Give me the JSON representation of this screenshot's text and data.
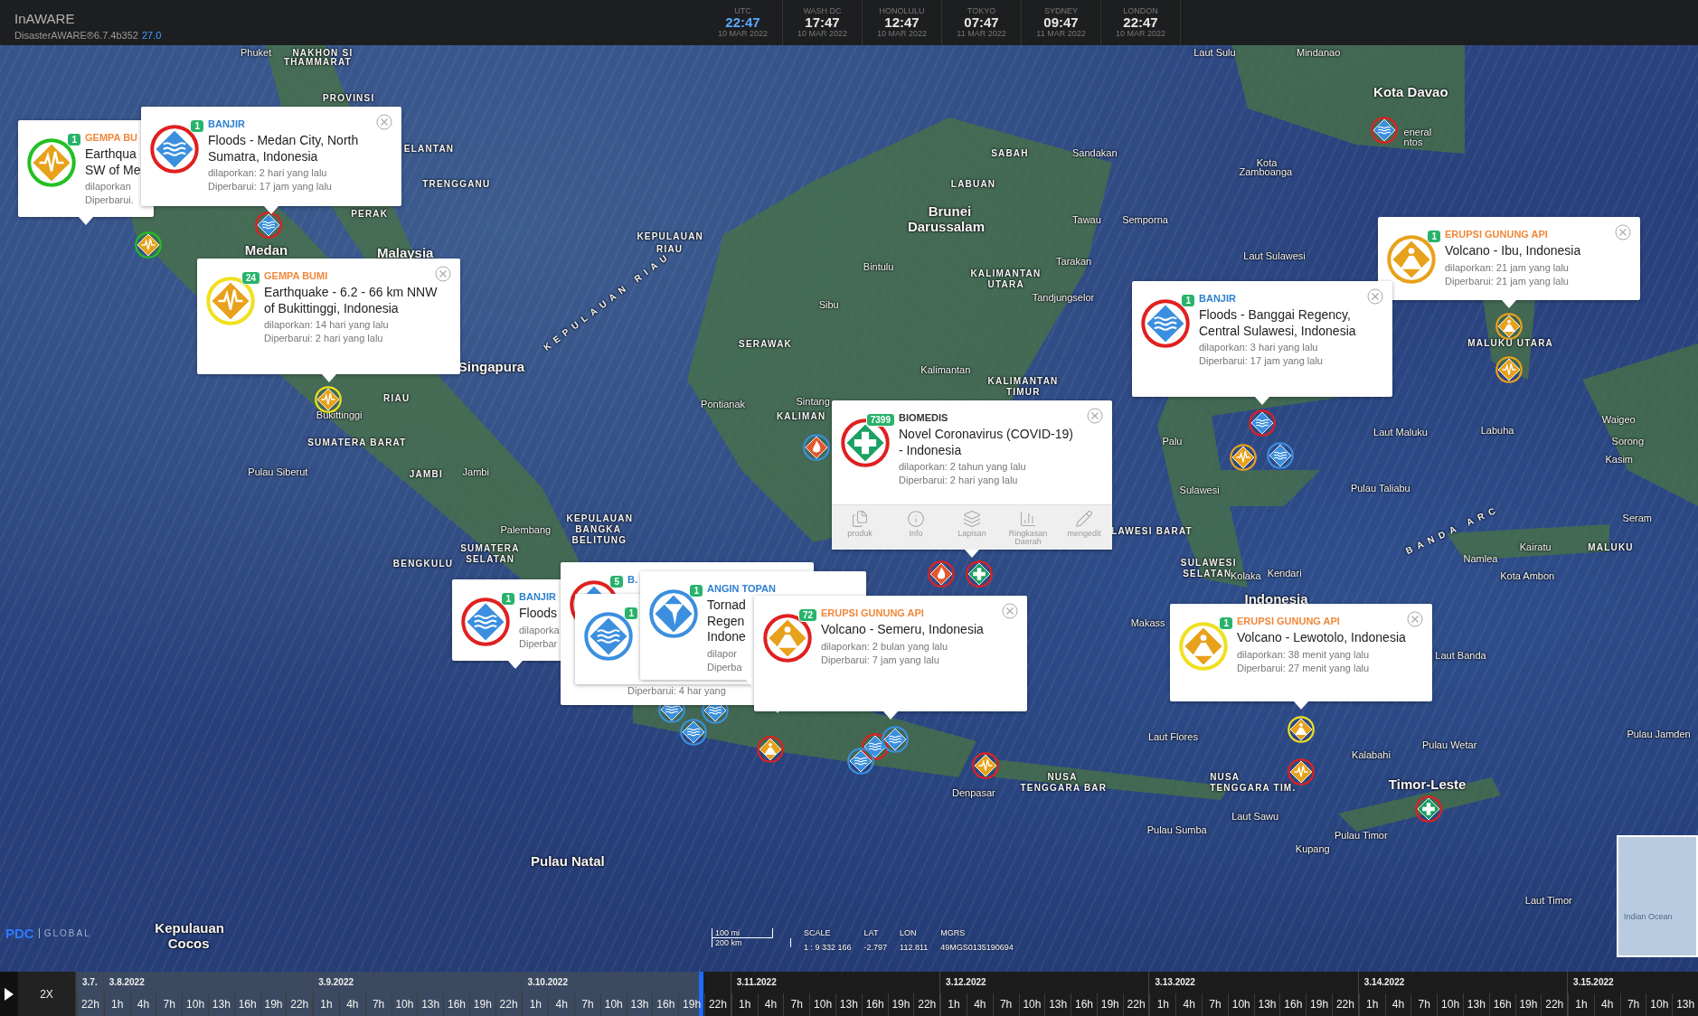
{
  "top_bar": {
    "app_name": "InAWARE",
    "version": "DisasterAWARE®6.7.4b352",
    "build": "27.0",
    "clocks": [
      {
        "city": "UTC",
        "time": "22:47",
        "date": "10 MAR 2022",
        "selected": true
      },
      {
        "city": "WASH DC",
        "time": "17:47",
        "date": "10 MAR 2022",
        "selected": false
      },
      {
        "city": "HONOLULU",
        "time": "12:47",
        "date": "10 MAR 2022",
        "selected": false
      },
      {
        "city": "TOKYO",
        "time": "07:47",
        "date": "11 MAR 2022",
        "selected": false
      },
      {
        "city": "SYDNEY",
        "time": "09:47",
        "date": "11 MAR 2022",
        "selected": false
      },
      {
        "city": "LONDON",
        "time": "22:47",
        "date": "10 MAR 2022",
        "selected": false
      }
    ]
  },
  "map": {
    "labels": [
      {
        "text": "Phuket",
        "kind": "place"
      },
      {
        "text": "NAKHON SI",
        "kind": "region"
      },
      {
        "text": "THAMMARAT",
        "kind": "region"
      },
      {
        "text": "PROVINSI",
        "kind": "region"
      },
      {
        "text": "ELANTAN",
        "kind": "region"
      },
      {
        "text": "TRENGGANU",
        "kind": "region"
      },
      {
        "text": "PERAK",
        "kind": "region"
      },
      {
        "text": "Medan",
        "kind": "country"
      },
      {
        "text": "Malaysia",
        "kind": "country"
      },
      {
        "text": "Singapura",
        "kind": "country"
      },
      {
        "text": "RIAU",
        "kind": "region"
      },
      {
        "text": "Bukittinggi",
        "kind": "place"
      },
      {
        "text": "SUMATERA BARAT",
        "kind": "region"
      },
      {
        "text": "Pulau Siberut",
        "kind": "place"
      },
      {
        "text": "JAMBI",
        "kind": "region"
      },
      {
        "text": "Jambi",
        "kind": "place"
      },
      {
        "text": "KEPULAUAN",
        "kind": "region"
      },
      {
        "text": "RIAU",
        "kind": "region"
      },
      {
        "text": "KEPULAUAN RIAU",
        "kind": "arc"
      },
      {
        "text": "Palembang",
        "kind": "place"
      },
      {
        "text": "KEPULAUAN",
        "kind": "region"
      },
      {
        "text": "BANGKA",
        "kind": "region"
      },
      {
        "text": "BELITUNG",
        "kind": "region"
      },
      {
        "text": "SUMATERA",
        "kind": "region"
      },
      {
        "text": "SELATAN",
        "kind": "region"
      },
      {
        "text": "BENGKULU",
        "kind": "region"
      },
      {
        "text": "Pontianak",
        "kind": "place"
      },
      {
        "text": "Sintang",
        "kind": "place"
      },
      {
        "text": "KALIMAN",
        "kind": "region"
      },
      {
        "text": "Sibu",
        "kind": "place"
      },
      {
        "text": "Bintulu",
        "kind": "place"
      },
      {
        "text": "SERAWAK",
        "kind": "region"
      },
      {
        "text": "SABAH",
        "kind": "region"
      },
      {
        "text": "Sandakan",
        "kind": "place"
      },
      {
        "text": "LABUAN",
        "kind": "region"
      },
      {
        "text": "Brunei",
        "kind": "country"
      },
      {
        "text": "Darussalam",
        "kind": "country"
      },
      {
        "text": "Tawau",
        "kind": "place"
      },
      {
        "text": "Semporna",
        "kind": "place"
      },
      {
        "text": "KALIMANTAN",
        "kind": "region"
      },
      {
        "text": "UTARA",
        "kind": "region"
      },
      {
        "text": "Tarakan",
        "kind": "place"
      },
      {
        "text": "Tandjungselor",
        "kind": "place"
      },
      {
        "text": "Kalimantan",
        "kind": "place"
      },
      {
        "text": "KALIMANTAN",
        "kind": "region"
      },
      {
        "text": "TIMUR",
        "kind": "region"
      },
      {
        "text": "Laut Sulu",
        "kind": "place"
      },
      {
        "text": "Mindanao",
        "kind": "place"
      },
      {
        "text": "Kota",
        "kind": "place"
      },
      {
        "text": "Zamboanga",
        "kind": "place"
      },
      {
        "text": "Kota Davao",
        "kind": "country"
      },
      {
        "text": "eneral",
        "kind": "place"
      },
      {
        "text": "ntos",
        "kind": "place"
      },
      {
        "text": "Laut Sulawesi",
        "kind": "place"
      },
      {
        "text": "MALUKU UTARA",
        "kind": "region"
      },
      {
        "text": "Labuha",
        "kind": "place"
      },
      {
        "text": "Laut Maluku",
        "kind": "place"
      },
      {
        "text": "Waigeo",
        "kind": "place"
      },
      {
        "text": "Sorong",
        "kind": "place"
      },
      {
        "text": "Kasim",
        "kind": "place"
      },
      {
        "text": "Seram",
        "kind": "place"
      },
      {
        "text": "Kairatu",
        "kind": "place"
      },
      {
        "text": "MALUKU",
        "kind": "region"
      },
      {
        "text": "Namlea",
        "kind": "place"
      },
      {
        "text": "Kota Ambon",
        "kind": "place"
      },
      {
        "text": "BANDA ARC",
        "kind": "arc"
      },
      {
        "text": "Palu",
        "kind": "place"
      },
      {
        "text": "Sulawesi",
        "kind": "place"
      },
      {
        "text": "Pulau Taliabu",
        "kind": "place"
      },
      {
        "text": "LAWESI BARAT",
        "kind": "region"
      },
      {
        "text": "SULAWESI",
        "kind": "region"
      },
      {
        "text": "SELATAN",
        "kind": "region"
      },
      {
        "text": "Kolaka",
        "kind": "place"
      },
      {
        "text": "Kendari",
        "kind": "place"
      },
      {
        "text": "Indonesia",
        "kind": "country"
      },
      {
        "text": "Makass",
        "kind": "place"
      },
      {
        "text": "Laut Banda",
        "kind": "place"
      },
      {
        "text": "Laut Flores",
        "kind": "place"
      },
      {
        "text": "Pulau Wetar",
        "kind": "place"
      },
      {
        "text": "Kalabahi",
        "kind": "place"
      },
      {
        "text": "NUSA",
        "kind": "region"
      },
      {
        "text": "TENGGARA TIM.",
        "kind": "region"
      },
      {
        "text": "Timor-Leste",
        "kind": "country"
      },
      {
        "text": "Laut Sawu",
        "kind": "place"
      },
      {
        "text": "Pulau Sumba",
        "kind": "place"
      },
      {
        "text": "Pulau Timor",
        "kind": "place"
      },
      {
        "text": "Kupang",
        "kind": "place"
      },
      {
        "text": "Laut Timor",
        "kind": "place"
      },
      {
        "text": "Pulau Jamden",
        "kind": "place"
      },
      {
        "text": "Denpasar",
        "kind": "place"
      },
      {
        "text": "NUSA",
        "kind": "region"
      },
      {
        "text": "TENGGARA BAR",
        "kind": "region"
      },
      {
        "text": "Pulau Natal",
        "kind": "country"
      },
      {
        "text": "Kepulauan",
        "kind": "country"
      },
      {
        "text": "Cocos",
        "kind": "country"
      }
    ],
    "markers": [
      {
        "kind": "earthquake",
        "color": "#22c022"
      },
      {
        "kind": "flood",
        "color": "#e02020"
      },
      {
        "kind": "earthquake",
        "color": "#f0e020"
      },
      {
        "kind": "flood",
        "color": "#e02020"
      },
      {
        "kind": "volcano",
        "color": "#e8a11a"
      },
      {
        "kind": "earthquake",
        "color": "#e8a11a"
      },
      {
        "kind": "flood",
        "color": "#e02020"
      },
      {
        "kind": "earthquake",
        "color": "#e8a11a"
      },
      {
        "kind": "flood",
        "color": "#3b8fde"
      },
      {
        "kind": "fire",
        "color": "#3b8fde"
      },
      {
        "kind": "fire",
        "color": "#e02020"
      },
      {
        "kind": "biomedical",
        "color": "#e02020"
      },
      {
        "kind": "volcano",
        "color": "#f0e020"
      },
      {
        "kind": "earthquake",
        "color": "#e02020"
      },
      {
        "kind": "biomedical",
        "color": "#e02020"
      },
      {
        "kind": "earthquake",
        "color": "#e02020"
      },
      {
        "kind": "volcano",
        "color": "#e02020"
      },
      {
        "kind": "flood",
        "color": "#3b8fde"
      },
      {
        "kind": "flood",
        "color": "#e02020"
      },
      {
        "kind": "flood",
        "color": "#3b8fde"
      },
      {
        "kind": "flood",
        "color": "#3b8fde"
      },
      {
        "kind": "flood",
        "color": "#3b8fde"
      },
      {
        "kind": "flood",
        "color": "#3b8fde"
      }
    ],
    "popups": [
      {
        "kind": "earthquake",
        "color": "#22c022",
        "badge": "1",
        "category": "GEMPA BU",
        "title": "Earthqua SW of Me",
        "reported": "dilaporkan",
        "updated": "Diperbarui.",
        "close_button": false
      },
      {
        "kind": "flood",
        "color": "#e02020",
        "badge": "1",
        "category": "BANJIR",
        "title": "Floods - Medan City, North Sumatra, Indonesia",
        "reported": "dilaporkan: 2 hari yang lalu",
        "updated": "Diperbarui: 17 jam yang lalu",
        "close_button": true
      },
      {
        "kind": "earthquake",
        "color": "#f0e020",
        "badge": "24",
        "category": "GEMPA BUMI",
        "title": "Earthquake - 6.2 - 66 km NNW of Bukittinggi, Indonesia",
        "reported": "dilaporkan: 14 hari yang lalu",
        "updated": "Diperbarui: 2 hari yang lalu",
        "close_button": true
      },
      {
        "kind": "biomedical",
        "color": "#e02020",
        "badge": "7399",
        "category": "BIOMEDIS",
        "title": "Novel Coronavirus (COVID-19) - Indonesia",
        "reported": "dilaporkan: 2 tahun yang lalu",
        "updated": "Diperbarui: 2 hari yang lalu",
        "close_button": true,
        "actions": [
          {
            "label": "produk"
          },
          {
            "label": "Info"
          },
          {
            "label": "Lapisan"
          },
          {
            "label": "Ringkasan Daerah"
          },
          {
            "label": "mengedit"
          }
        ]
      },
      {
        "kind": "volcano",
        "color": "#e8a11a",
        "badge": "1",
        "category": "ERUPSI GUNUNG API",
        "title": "Volcano - Ibu, Indonesia",
        "reported": "dilaporkan: 21 jam yang lalu",
        "updated": "Diperbarui: 21 jam yang lalu",
        "close_button": true
      },
      {
        "kind": "flood",
        "color": "#e02020",
        "badge": "1",
        "category": "BANJIR",
        "title": "Floods - Banggai Regency, Central Sulawesi, Indonesia",
        "reported": "dilaporkan: 3 hari yang lalu",
        "updated": "Diperbarui: 17 jam yang lalu",
        "close_button": true
      },
      {
        "kind": "flood",
        "color": "#e02020",
        "badge": "1",
        "category": "BANJIR",
        "title": "Floods",
        "reported": "dilaporka",
        "updated": "Diperbar",
        "close_button": false
      },
      {
        "kind": "flood",
        "color": "#e02020",
        "badge": "5",
        "category": "B.",
        "updated": "Diperbarui: 4 har yang",
        "close_button": false
      },
      {
        "kind": "flood",
        "color": "#3b8fde",
        "badge": "1",
        "close_button": false
      },
      {
        "kind": "storm",
        "color": "#3b8fde",
        "badge": "1",
        "category": "ANGIN TOPAN",
        "title": "Tornad Regen Indone",
        "reported": "dilapor",
        "updated": "Diperba",
        "close_button": false
      },
      {
        "kind": "volcano",
        "color": "#e02020",
        "badge": "72",
        "category": "ERUPSI GUNUNG API",
        "title": "Volcano - Semeru, Indonesia",
        "reported": "dilaporkan: 2 bulan yang lalu",
        "updated": "Diperbarui: 7 jam yang lalu",
        "close_button": true
      },
      {
        "kind": "volcano",
        "color": "#f0e020",
        "badge": "1",
        "category": "ERUPSI GUNUNG API",
        "title": "Volcano - Lewotolo, Indonesia",
        "reported": "dilaporkan: 38 menit yang lalu",
        "updated": "Diperbarui: 27 menit yang lalu",
        "close_button": true
      }
    ],
    "logo": {
      "name": "PDC",
      "suffix": "GLOBAL"
    },
    "scale": {
      "miles": "100 mi",
      "km": "200 km",
      "readouts": [
        {
          "label": "SCALE",
          "value": "1 : 9 332 166"
        },
        {
          "label": "LAT",
          "value": "-2.797"
        },
        {
          "label": "LON",
          "value": "112.811"
        },
        {
          "label": "MGRS",
          "value": "49MGS0135190694"
        }
      ]
    },
    "minimap": {
      "label": "Indian Ocean"
    }
  },
  "timeline": {
    "speed": "2X",
    "playhead": {
      "level": 0.387
    },
    "days": [
      {
        "date": "3.7.",
        "hours": [
          "22h"
        ]
      },
      {
        "date": "3.8.2022",
        "hours": [
          "1h",
          "4h",
          "7h",
          "10h",
          "13h",
          "16h",
          "19h",
          "22h"
        ]
      },
      {
        "date": "3.9.2022",
        "hours": [
          "1h",
          "4h",
          "7h",
          "10h",
          "13h",
          "16h",
          "19h",
          "22h"
        ]
      },
      {
        "date": "3.10.2022",
        "hours": [
          "1h",
          "4h",
          "7h",
          "10h",
          "13h",
          "16h",
          "19h",
          "22h"
        ]
      },
      {
        "date": "3.11.2022",
        "hours": [
          "1h",
          "4h",
          "7h",
          "10h",
          "13h",
          "16h",
          "19h",
          "22h"
        ]
      },
      {
        "date": "3.12.2022",
        "hours": [
          "1h",
          "4h",
          "7h",
          "10h",
          "13h",
          "16h",
          "19h",
          "22h"
        ]
      },
      {
        "date": "3.13.2022",
        "hours": [
          "1h",
          "4h",
          "7h",
          "10h",
          "13h",
          "16h",
          "19h",
          "22h"
        ]
      },
      {
        "date": "3.14.2022",
        "hours": [
          "1h",
          "4h",
          "7h",
          "10h",
          "13h",
          "16h",
          "19h",
          "22h"
        ]
      },
      {
        "date": "3.15.2022",
        "hours": [
          "1h",
          "4h",
          "7h",
          "10h",
          "13h"
        ]
      }
    ]
  }
}
